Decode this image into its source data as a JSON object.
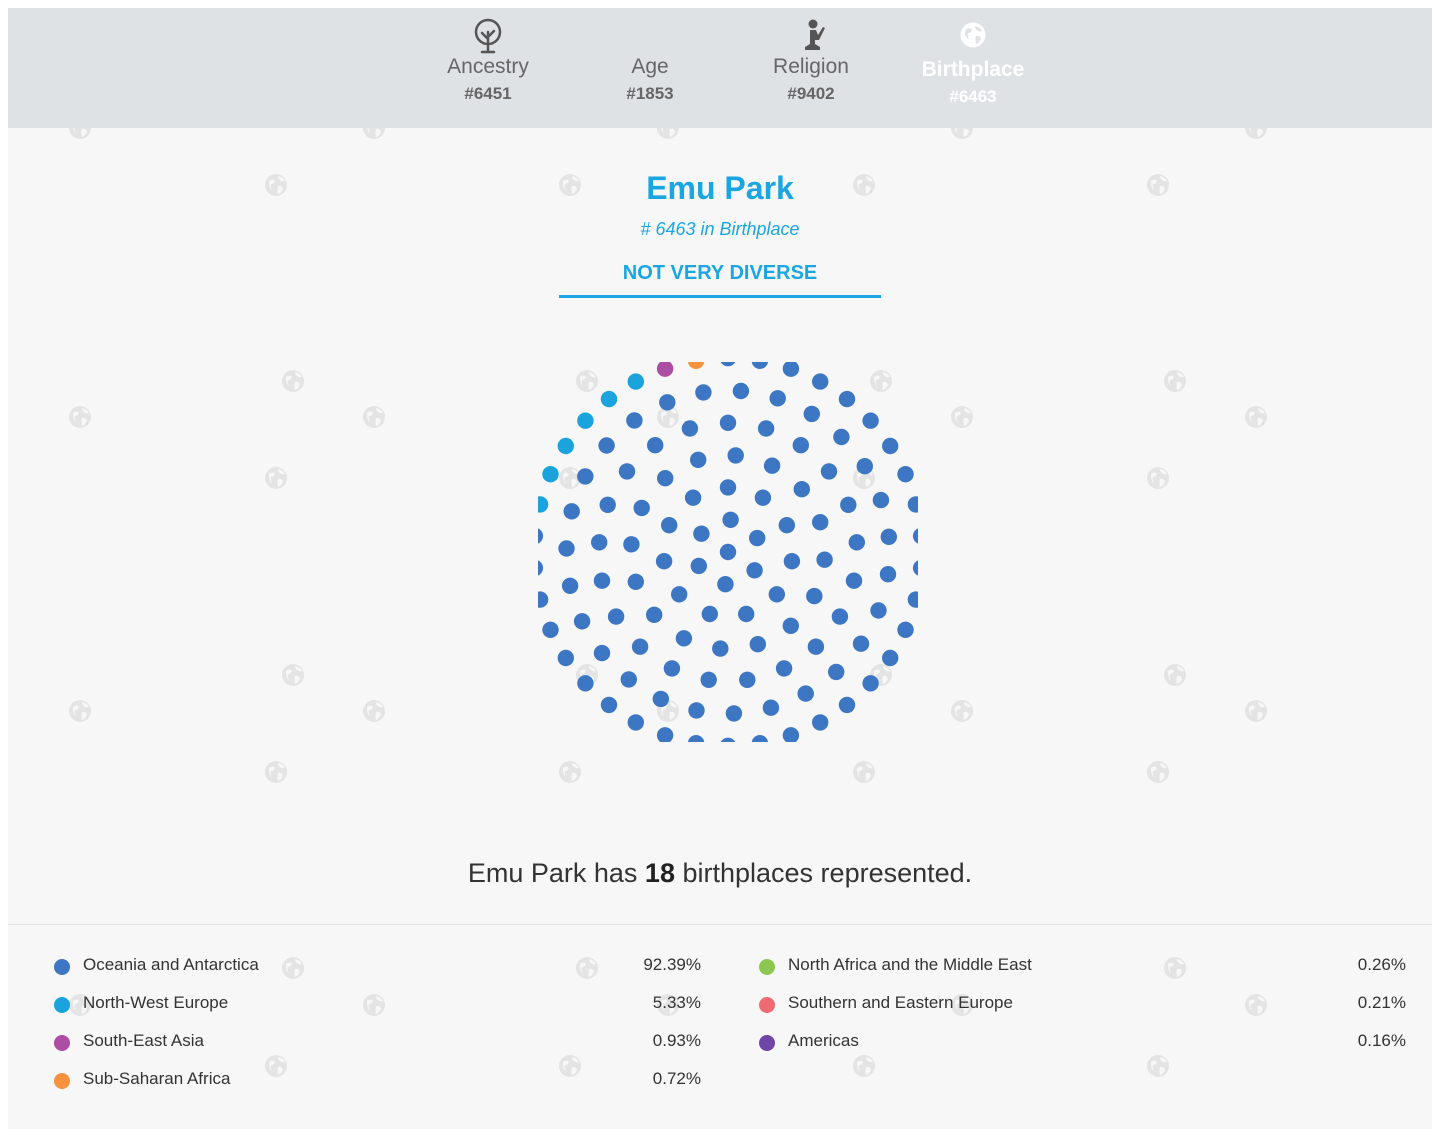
{
  "nav": {
    "tabs": [
      {
        "label": "Ancestry",
        "rank": "#6451",
        "icon": "tree-icon",
        "active": false
      },
      {
        "label": "Age",
        "rank": "#1853",
        "icon": "age-icon",
        "active": false
      },
      {
        "label": "Religion",
        "rank": "#9402",
        "icon": "praying-icon",
        "active": false
      },
      {
        "label": "Birthplace",
        "rank": "#6463",
        "icon": "globe-icon",
        "active": true
      }
    ]
  },
  "place": {
    "title": "Emu Park",
    "rank_text": "# 6463 in Birthplace",
    "diversity_label": "NOT VERY DIVERSE"
  },
  "summary": {
    "prefix": "Emu Park has",
    "count": "18",
    "suffix": "birthplaces represented."
  },
  "colors": {
    "accent": "#1aa6e2",
    "nav_bg": "#dfe2e5",
    "page_bg": "#f7f7f7"
  },
  "chart_data": {
    "type": "dot-cluster",
    "total_dots": 120,
    "series": [
      {
        "name": "Oceania and Antarctica",
        "value": "92.39%",
        "percent": 92.39,
        "color": "#3d77c4",
        "dots": 113
      },
      {
        "name": "North-West Europe",
        "value": "5.33%",
        "percent": 5.33,
        "color": "#1aa3dd",
        "dots": 6
      },
      {
        "name": "South-East Asia",
        "value": "0.93%",
        "percent": 0.93,
        "color": "#ad4ea4",
        "dots": 1
      },
      {
        "name": "Sub-Saharan Africa",
        "value": "0.72%",
        "percent": 0.72,
        "color": "#f5923e",
        "dots": 1
      },
      {
        "name": "North Africa and the Middle East",
        "value": "0.26%",
        "percent": 0.26,
        "color": "#8dc74f",
        "dots": 0
      },
      {
        "name": "Southern and Eastern Europe",
        "value": "0.21%",
        "percent": 0.21,
        "color": "#ee6b73",
        "dots": 0
      },
      {
        "name": "Americas",
        "value": "0.16%",
        "percent": 0.16,
        "color": "#6e46a5",
        "dots": 0
      }
    ]
  }
}
